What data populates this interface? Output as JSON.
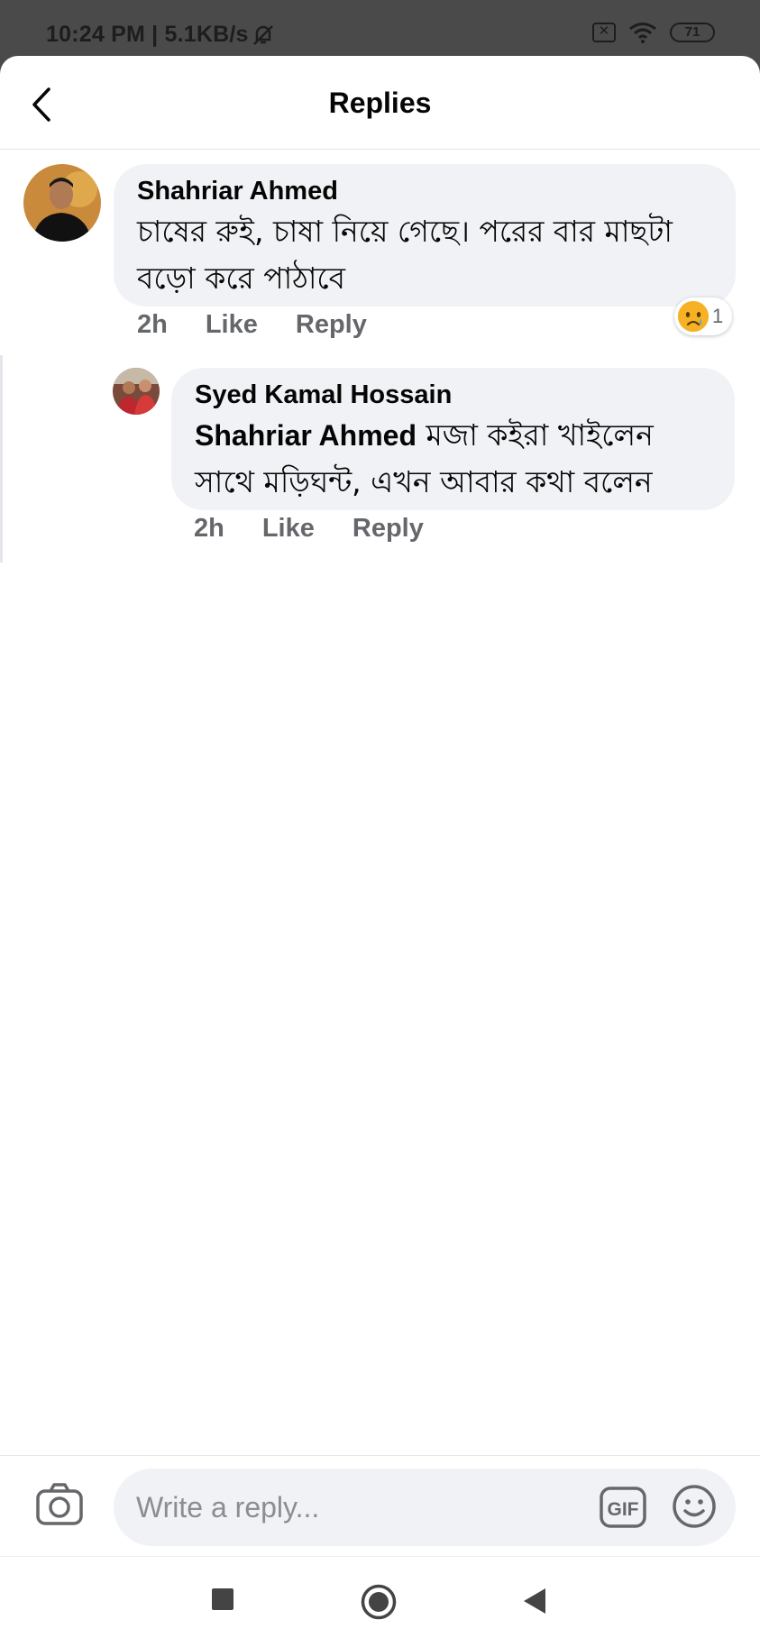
{
  "status_bar": {
    "time": "10:24 PM | 5.1KB/s",
    "battery": "71",
    "icons": [
      "mute-bell-icon",
      "sim-x-icon",
      "wifi-icon",
      "battery-icon"
    ]
  },
  "header": {
    "title": "Replies",
    "back_icon": "chevron-left-icon"
  },
  "comments": [
    {
      "author": "Shahriar Ahmed",
      "text": "চাষের রুই, চাষা নিয়ে গেছে। পরের বার মাছটা বড়ো করে পাঠাবে",
      "time": "2h",
      "like_label": "Like",
      "reply_label": "Reply",
      "reaction": {
        "icon": "sad-face-icon",
        "count": "1"
      }
    },
    {
      "author": "Syed Kamal Hossain",
      "mention": "Shahriar Ahmed",
      "text": " মজা কইরা খাইলেন সাথে মড়িঘন্ট, এখন আবার কথা বলেন",
      "time": "2h",
      "like_label": "Like",
      "reply_label": "Reply"
    }
  ],
  "composer": {
    "placeholder": "Write a reply...",
    "gif_label": "GIF",
    "camera_icon": "camera-icon",
    "emoji_icon": "smiley-icon"
  },
  "nav": {
    "icons": [
      "recents-square-icon",
      "home-circle-icon",
      "back-triangle-icon"
    ]
  },
  "colors": {
    "bubble": "#f0f2f5",
    "meta_text": "#65676b",
    "reaction_yellow": "#f7b125",
    "status_bar": "#4a4a4a"
  }
}
